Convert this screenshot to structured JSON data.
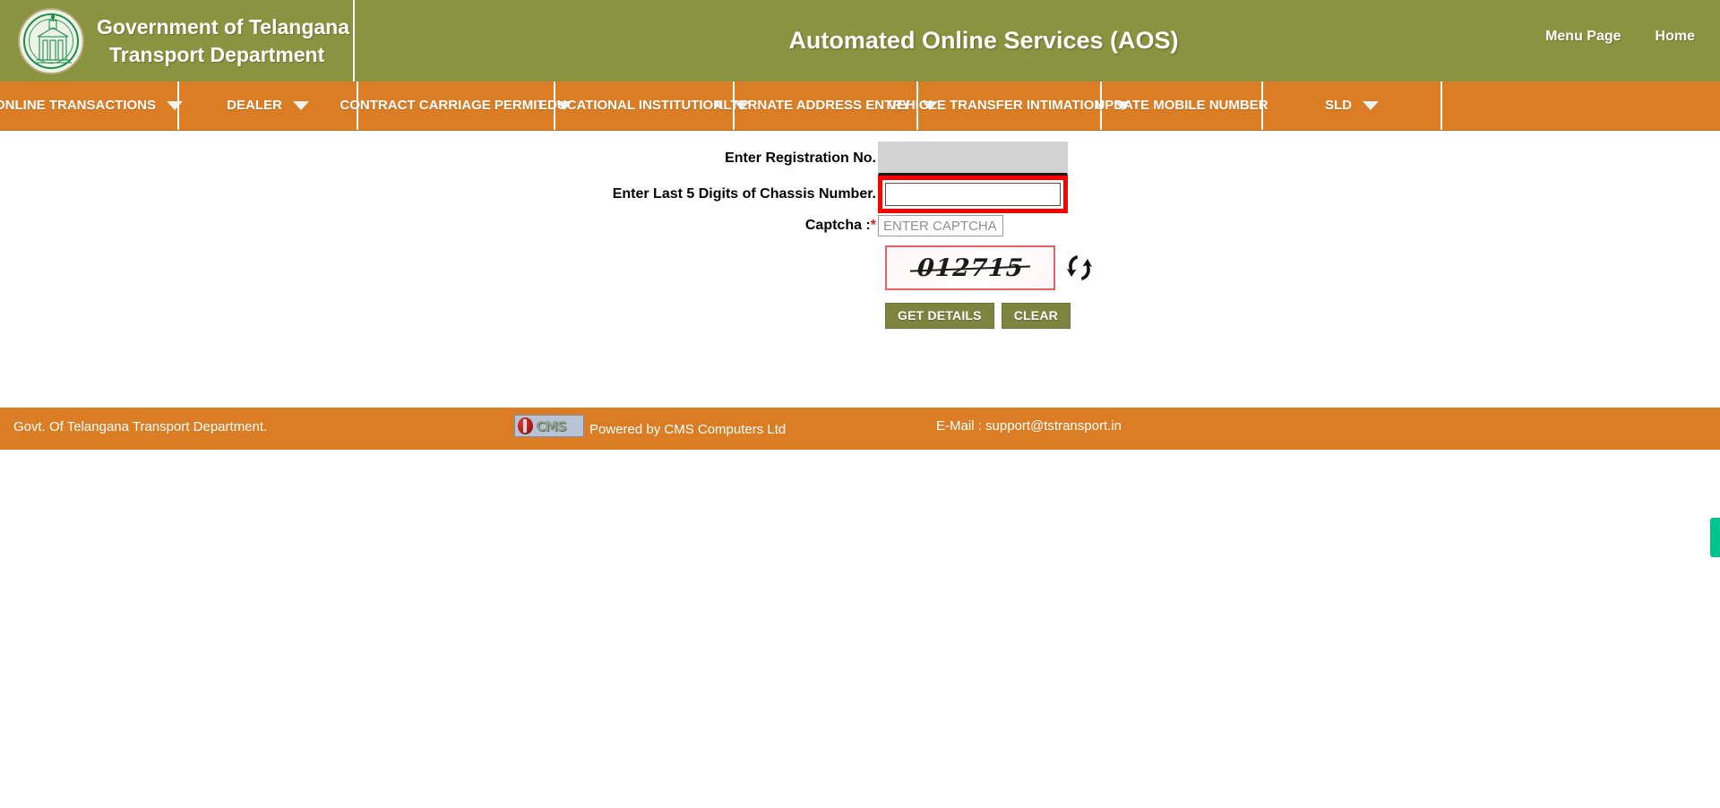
{
  "header": {
    "org_line1": "Government of Telangana",
    "org_line2": "Transport Department",
    "title": "Automated Online Services (AOS)",
    "links": [
      {
        "label": "Menu Page",
        "name": "menu-page-link"
      },
      {
        "label": "Home",
        "name": "home-link"
      }
    ],
    "emblem_icon": "telangana-state-emblem-icon"
  },
  "nav": {
    "items": [
      {
        "label": "ONLINE TRANSACTIONS",
        "has_caret": true
      },
      {
        "label": "DEALER",
        "has_caret": true
      },
      {
        "label": "CONTRACT CARRIAGE PERMIT",
        "has_caret": true
      },
      {
        "label": "EDUCATIONAL INSTITUTION",
        "has_caret": true
      },
      {
        "label": "ALTERNATE ADDRESS ENTRY",
        "has_caret": true
      },
      {
        "label": "VEHICLE TRANSFER INTIMATION",
        "has_caret": true
      },
      {
        "label": "UPDATE MOBILE NUMBER",
        "has_caret": false
      },
      {
        "label": "SLD",
        "has_caret": true
      }
    ]
  },
  "form": {
    "registration": {
      "label": "Enter Registration No.",
      "value": "",
      "placeholder": ""
    },
    "chassis": {
      "label": "Enter Last 5 Digits of Chassis Number.",
      "value": "",
      "placeholder": "",
      "highlight_color": "#ff0000"
    },
    "captcha_entry": {
      "label": "Captcha :",
      "required_mark": "*",
      "value": "",
      "placeholder": "ENTER CAPTCHA"
    },
    "captcha_image": {
      "text": "012715",
      "refresh_icon": "refresh-arrows-icon"
    },
    "buttons": [
      {
        "label": "GET DETAILS",
        "name": "get-details-button"
      },
      {
        "label": "CLEAR",
        "name": "clear-button"
      }
    ]
  },
  "footer": {
    "left": "Govt. Of Telangana Transport Department.",
    "cms_logo_text": "CMS",
    "powered": "Powered by CMS Computers Ltd",
    "email": "E-Mail : support@tstransport.in"
  },
  "colors": {
    "header_green": "#8a933f",
    "nav_orange": "#da7d25",
    "button_olive": "#7d8440",
    "highlight_red": "#ff0000",
    "edge_tab_green": "#00c48c"
  }
}
